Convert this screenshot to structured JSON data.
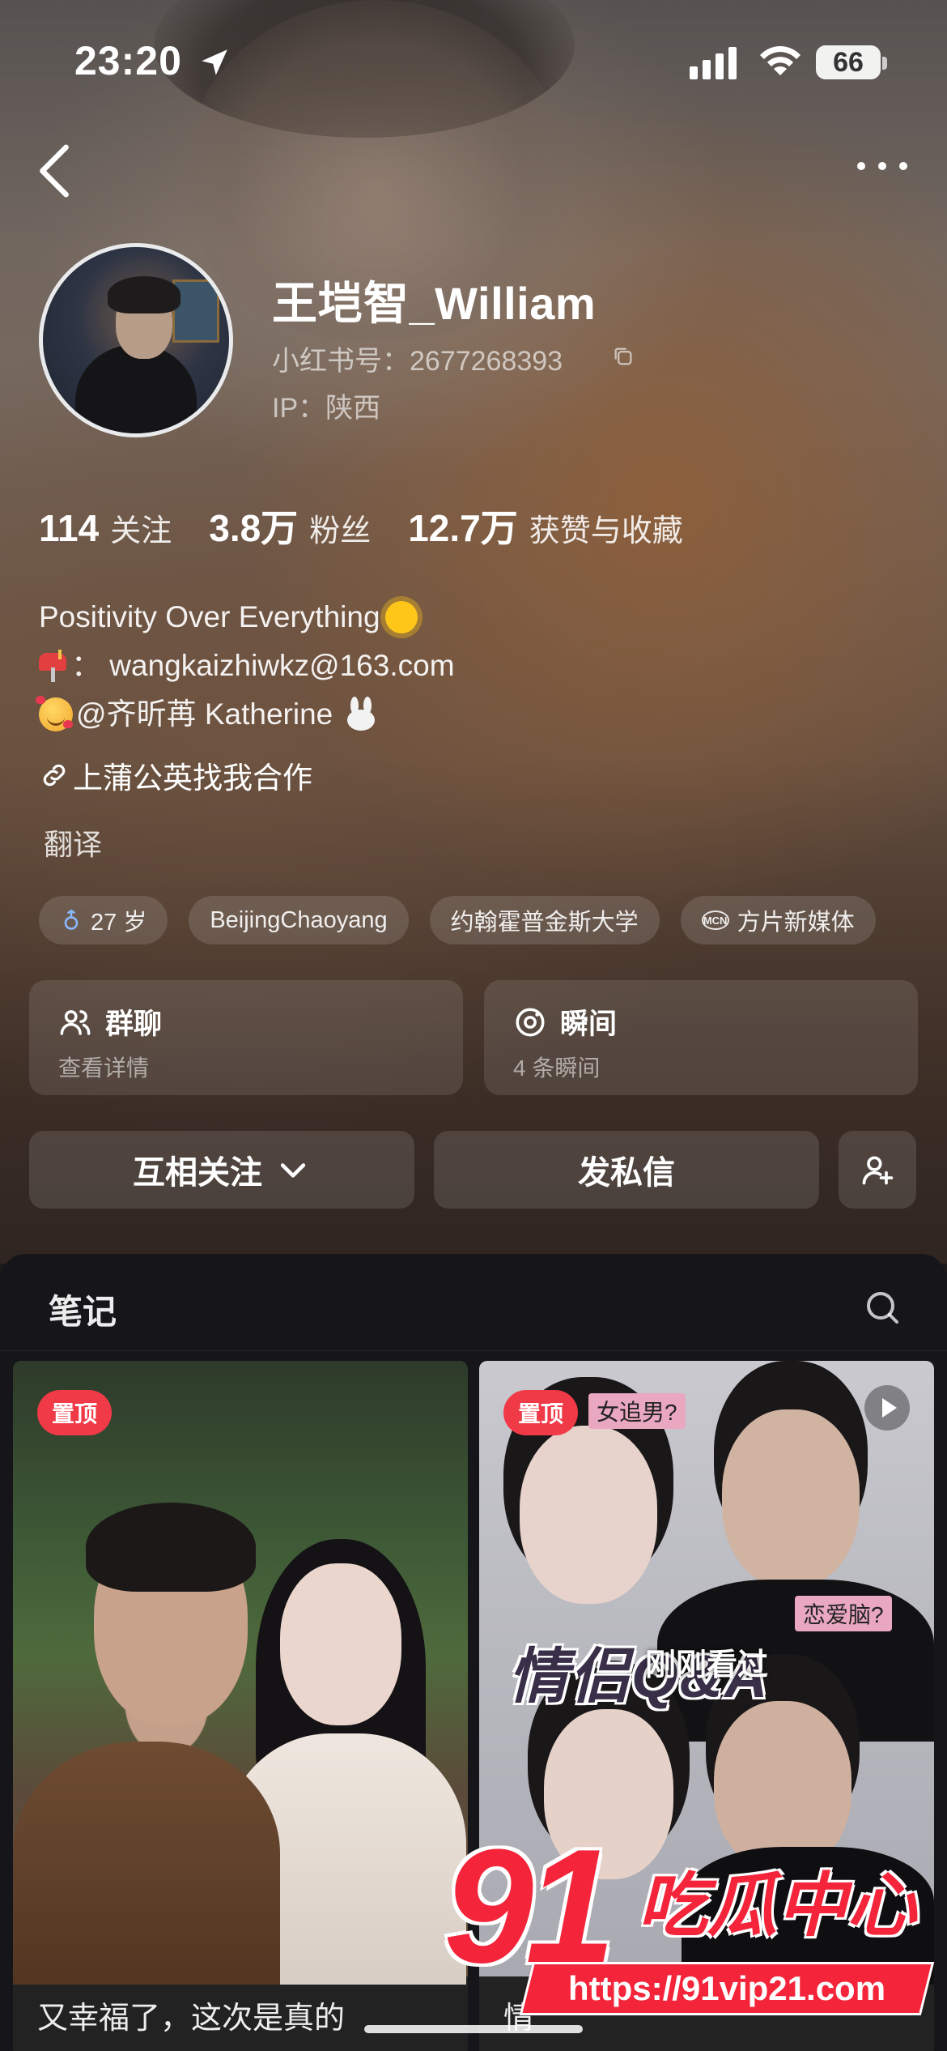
{
  "status_bar": {
    "time": "23:20",
    "battery": "66"
  },
  "profile": {
    "name": "王垲智_William",
    "red_id": "小红书号：2677268393",
    "ip": "IP：陕西",
    "stats": [
      {
        "num": "114",
        "label": "关注"
      },
      {
        "num": "3.8万",
        "label": "粉丝"
      },
      {
        "num": "12.7万",
        "label": "获赞与收藏"
      }
    ],
    "bio": {
      "line1": "Positivity Over Everything",
      "line2": "：  wangkaizhiwkz@163.com",
      "line3": "@齐昕苒 Katherine"
    },
    "link": "上蒲公英找我合作",
    "translate": "翻译",
    "tags": [
      {
        "icon": "gender-male-icon",
        "label": "27 岁"
      },
      {
        "icon": "",
        "label": "BeijingChaoyang"
      },
      {
        "icon": "",
        "label": "约翰霍普金斯大学"
      },
      {
        "icon": "mcn-icon",
        "label": "方片新媒体",
        "badge": "MCN"
      }
    ],
    "cards": [
      {
        "icon": "group-chat-icon",
        "title": "群聊",
        "sub": "查看详情"
      },
      {
        "icon": "moment-icon",
        "title": "瞬间",
        "sub": "4 条瞬间"
      }
    ],
    "actions": {
      "follow": "互相关注",
      "message": "发私信"
    }
  },
  "notes": {
    "title": "笔记",
    "posts": [
      {
        "pin": "置顶",
        "title": "又幸福了，这次是真的"
      },
      {
        "pin": "置顶",
        "title": "情",
        "overlay": "刚刚看过",
        "cover_text": "情侣Q&A",
        "cover_tags": [
          "女追男?",
          "恋爱脑?"
        ]
      }
    ]
  },
  "watermark": {
    "brand_num": "91",
    "brand_cn": "吃瓜中心",
    "url": "https://91vip21.com"
  },
  "colors": {
    "accent_red": "#f03a47",
    "notes_bg": "#16161a"
  }
}
